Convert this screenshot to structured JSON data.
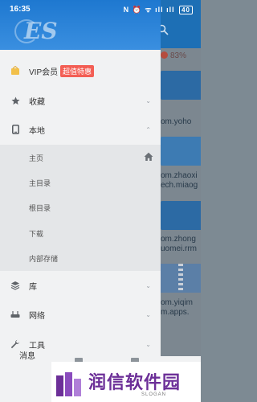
{
  "status_bar": {
    "time": "16:35",
    "battery": "40",
    "icons_text": "N ⏰ ᯤ ıll ıll"
  },
  "background_app": {
    "storage_percent": "83%",
    "files": [
      "om.yoho",
      "om.zhaoxi\nech.miaog",
      "om.zhong\nuomei.rrm",
      "om.yiqim\nm.apps."
    ]
  },
  "drawer": {
    "vip": {
      "label": "VIP会员",
      "badge": "超值特惠"
    },
    "items": [
      {
        "label": "收藏",
        "icon": "star-icon",
        "expanded": false
      },
      {
        "label": "本地",
        "icon": "phone-icon",
        "expanded": true
      },
      {
        "label": "库",
        "icon": "stack-icon",
        "expanded": false
      },
      {
        "label": "网络",
        "icon": "network-icon",
        "expanded": false
      },
      {
        "label": "工具",
        "icon": "wrench-icon",
        "expanded": false
      }
    ],
    "local_sub": [
      "主页",
      "主目录",
      "根目录",
      "下载",
      "内部存储"
    ]
  },
  "footer": {
    "label": "消息"
  },
  "watermark": {
    "title": "润信软件园",
    "slogan": "SLOGAN"
  },
  "colors": {
    "header_blue": "#1e78d0",
    "vip_red": "#f35e54",
    "watermark_purple": "#6c2f98"
  }
}
